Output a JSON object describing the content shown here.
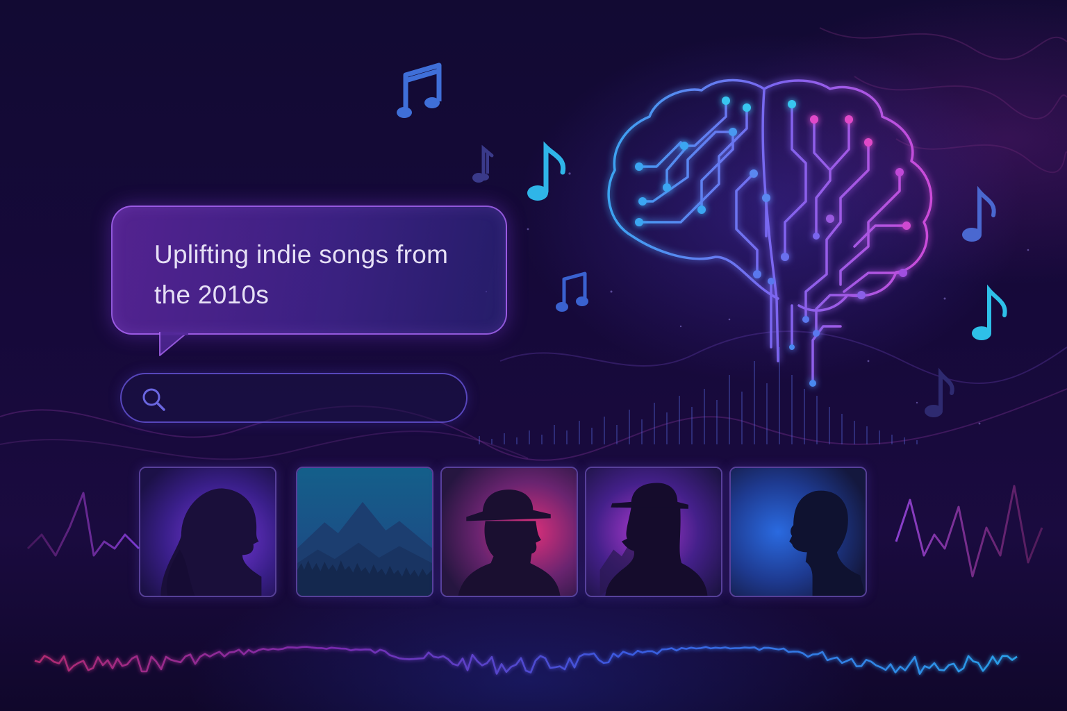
{
  "prompt_bubble": {
    "text": "Uplifting indie songs from the 2010s"
  },
  "search": {
    "value": "",
    "icon": "search-icon"
  },
  "artist_cards": [
    {
      "icon": "female-silhouette-icon"
    },
    {
      "icon": "mountain-landscape-icon"
    },
    {
      "icon": "man-in-hat-silhouette-icon"
    },
    {
      "icon": "man-in-bowler-hat-silhouette-icon"
    },
    {
      "icon": "man-profile-silhouette-icon"
    }
  ],
  "decor": {
    "brain": "circuit-brain-icon",
    "notes": "music-note-icon",
    "waveform": "audio-waveform"
  },
  "colors": {
    "background": "#140a36",
    "accent_cyan": "#38c8f0",
    "accent_magenta": "#e040c0",
    "accent_purple": "#8a5cff"
  }
}
